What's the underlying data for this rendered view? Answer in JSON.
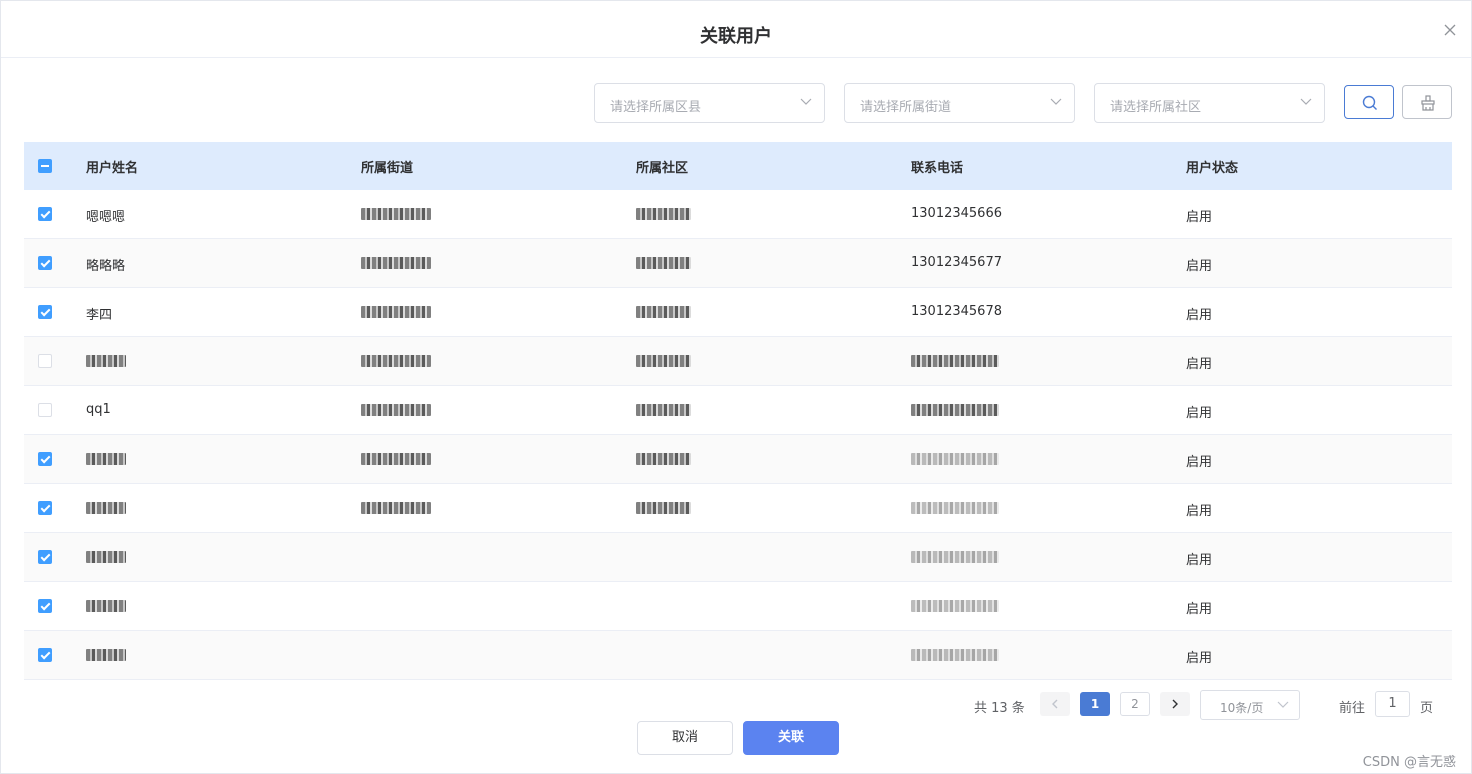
{
  "dialog": {
    "title": "关联用户"
  },
  "filters": {
    "district_placeholder": "请选择所属区县",
    "street_placeholder": "请选择所属街道",
    "community_placeholder": "请选择所属社区"
  },
  "table": {
    "columns": [
      "用户姓名",
      "所属街道",
      "所属社区",
      "联系电话",
      "用户状态"
    ],
    "rows": [
      {
        "name": "嗯嗯嗯",
        "street": "",
        "community": "",
        "phone": "13012345666",
        "status": "启用",
        "checked": true
      },
      {
        "name": "略略略",
        "street": "",
        "community": "",
        "phone": "13012345677",
        "status": "启用",
        "checked": true
      },
      {
        "name": "李四",
        "street": "",
        "community": "",
        "phone": "13012345678",
        "status": "启用",
        "checked": true
      },
      {
        "name": "",
        "street": "",
        "community": "",
        "phone": "",
        "status": "启用",
        "checked": false
      },
      {
        "name": "qq1",
        "street": "",
        "community": "",
        "phone": "",
        "status": "启用",
        "checked": false
      },
      {
        "name": "",
        "street": "",
        "community": "",
        "phone": "",
        "status": "启用",
        "checked": true
      },
      {
        "name": "",
        "street": "",
        "community": "",
        "phone": "",
        "status": "启用",
        "checked": true
      },
      {
        "name": "",
        "street": "",
        "community": "",
        "phone": "",
        "status": "启用",
        "checked": true
      },
      {
        "name": "",
        "street": "",
        "community": "",
        "phone": "",
        "status": "启用",
        "checked": true
      },
      {
        "name": "",
        "street": "",
        "community": "",
        "phone": "",
        "status": "启用",
        "checked": true
      }
    ]
  },
  "pagination": {
    "total_text": "共 13 条",
    "pages": [
      "1",
      "2"
    ],
    "current_page": "1",
    "page_size": "10条/页",
    "goto_label": "前往",
    "goto_value": "1",
    "goto_suffix": "页"
  },
  "footer": {
    "cancel_label": "取消",
    "confirm_label": "关联"
  },
  "watermark": "CSDN @言无惑",
  "colors": {
    "primary": "#5b83f0",
    "header_bg": "#deebfd",
    "checkbox": "#409eff"
  }
}
